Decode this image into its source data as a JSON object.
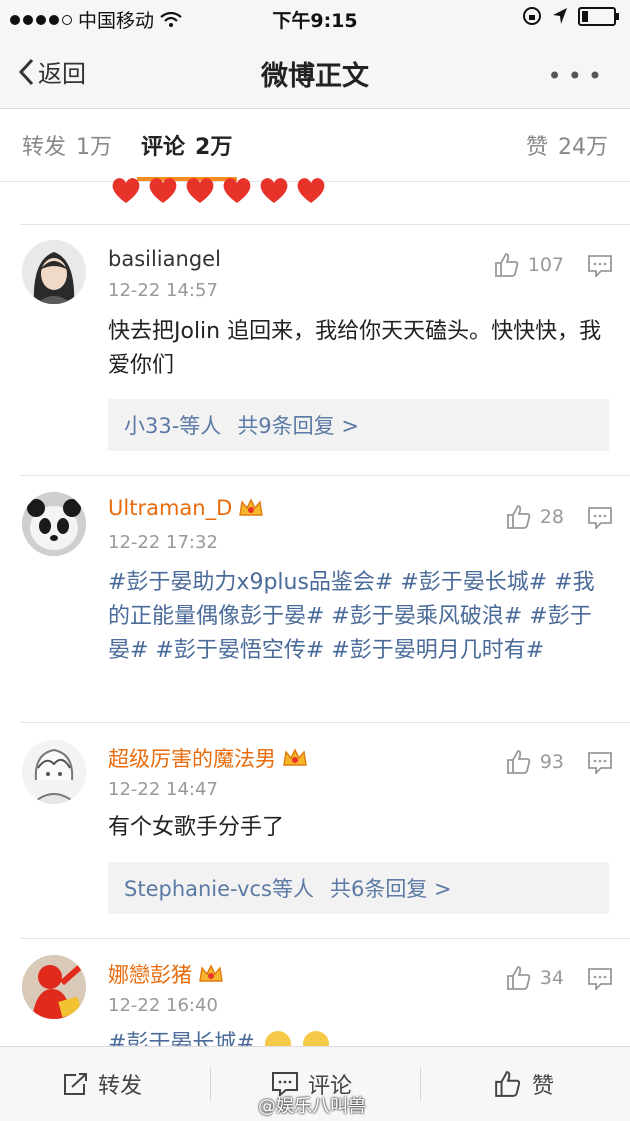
{
  "status_bar": {
    "carrier": "中国移动",
    "time": "下午9:15"
  },
  "nav": {
    "back_label": "返回",
    "title": "微博正文"
  },
  "tabs": {
    "repost": {
      "label": "转发",
      "count": "1万"
    },
    "comment": {
      "label": "评论",
      "count": "2万"
    },
    "like": {
      "label": "赞",
      "count": "24万"
    }
  },
  "comments": [
    {
      "user": "basiliangel",
      "date": "12-22 14:57",
      "likes": "107",
      "text": "快去把Jolin 追回来，我给你天天磕头。快快快，我爱你们",
      "reply_users": "小33-等人",
      "reply_count": "共9条回复 >"
    },
    {
      "user": "Ultraman_D",
      "date": "12-22 17:32",
      "likes": "28",
      "text": "#彭于晏助力x9plus品鉴会# #彭于晏长城# #我的正能量偶像彭于晏# #彭于晏乘风破浪# #彭于晏# #彭于晏悟空传# #彭于晏明月几时有#"
    },
    {
      "user": "超级厉害的魔法男",
      "date": "12-22 14:47",
      "likes": "93",
      "text": "有个女歌手分手了",
      "reply_users": "Stephanie-vcs等人",
      "reply_count": "共6条回复 >"
    },
    {
      "user": "娜戀彭猪",
      "date": "12-22 16:40",
      "likes": "34",
      "text": "#彭于晏长城#"
    }
  ],
  "bottom_bar": {
    "repost": "转发",
    "comment": "评论",
    "like": "赞"
  },
  "watermark": "@娱乐八叫兽",
  "colors": {
    "vip_name": "#e86b0c",
    "tag_link": "#4a6b99",
    "tab_underline": "#f58c1f"
  }
}
